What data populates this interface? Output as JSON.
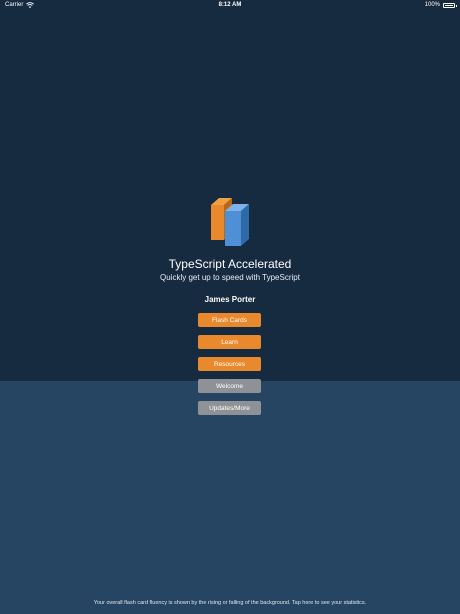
{
  "status_bar": {
    "carrier": "Carrier",
    "time": "8:12 AM",
    "battery": "100%"
  },
  "app": {
    "title": "TypeScript Accelerated",
    "subtitle": "Quickly get up to speed with TypeScript",
    "user_name": "James Porter"
  },
  "menu": {
    "flash_cards": "Flash Cards",
    "learn": "Learn",
    "resources": "Resources",
    "welcome": "Welcome",
    "updates_more": "Updates/More"
  },
  "footer": {
    "fluency_text": "Your overall flash card fluency is shown by the rising or falling of the background. Tap here to see your statistics."
  },
  "fluency": {
    "level": 0.38
  },
  "colors": {
    "background_dark": "#162a40",
    "background_fluency": "#264563",
    "accent_orange": "#e8892d",
    "button_gray": "#8e9296",
    "logo_blue": "#4f8fd6"
  }
}
